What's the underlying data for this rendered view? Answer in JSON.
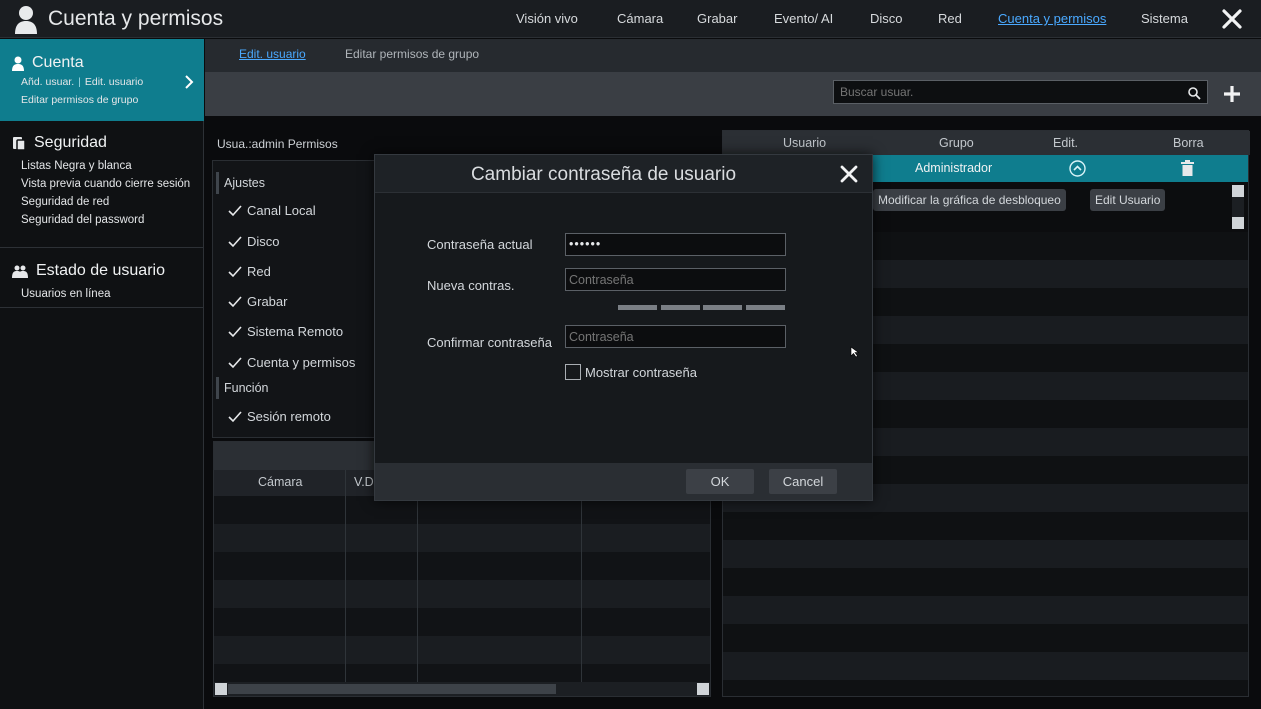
{
  "app": {
    "title": "Cuenta y permisos"
  },
  "nav": {
    "items": [
      "Visión vivo",
      "Cámara",
      "Grabar",
      "Evento/ AI",
      "Disco",
      "Red",
      "Cuenta y permisos",
      "Sistema"
    ],
    "active": "Cuenta y permisos"
  },
  "sidebar": {
    "cuenta": {
      "label": "Cuenta",
      "sub_add": "Añd. usuar.",
      "sub_edit": "Edit. usuario",
      "sub_group": "Editar permisos de grupo"
    },
    "seguridad": {
      "label": "Seguridad",
      "items": [
        "Listas Negra y blanca",
        "Vista previa cuando cierre sesión",
        "Seguridad de red",
        "Seguridad del password"
      ]
    },
    "estado": {
      "label": "Estado de usuario",
      "items": [
        "Usuarios en línea"
      ]
    }
  },
  "subtabs": [
    "Edit. usuario",
    "Editar permisos de grupo"
  ],
  "search": {
    "placeholder": "Buscar usuar."
  },
  "permissions": {
    "title": "Usua.:admin Permisos",
    "cat_settings": "Ajustes",
    "settings": [
      "Canal Local",
      "Disco",
      "Red",
      "Grabar",
      "Sistema Remoto",
      "Cuenta y permisos"
    ],
    "cat_function": "Función",
    "function": [
      "Sesión remoto"
    ]
  },
  "camera_table": {
    "columns": [
      "Cámara",
      "V.D"
    ]
  },
  "users_table": {
    "columns": [
      "Usuario",
      "Grupo",
      "Edit.",
      "Borra"
    ],
    "rows": [
      {
        "group": "Administrador"
      }
    ],
    "actions": [
      "Modificar la gráfica de desbloqueo",
      "Edit Usuario"
    ]
  },
  "modal": {
    "title": "Cambiar contraseña de usuario",
    "current_label": "Contraseña actual",
    "current_value": "••••••",
    "new_label": "Nueva contras.",
    "new_placeholder": "Contraseña",
    "confirm_label": "Confirmar contraseña",
    "confirm_placeholder": "Contraseña",
    "show_label": "Mostrar contraseña",
    "ok": "OK",
    "cancel": "Cancel"
  },
  "colors": {
    "accent": "#0f7d8e",
    "link": "#4aa9ff"
  }
}
